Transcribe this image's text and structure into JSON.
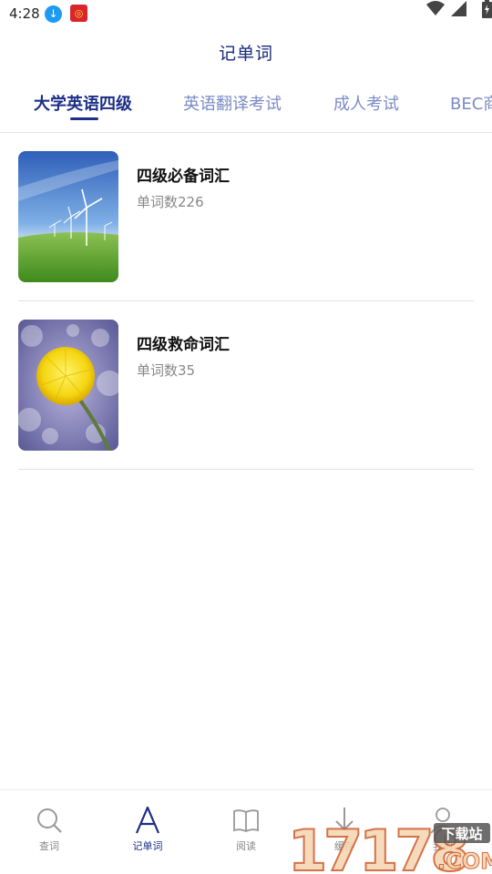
{
  "status_bar": {
    "time": "4:28",
    "download_icon": "download-circle-icon",
    "app_icon": "red-app-icon"
  },
  "header": {
    "title": "记单词"
  },
  "tabs": [
    {
      "label": "大学英语四级",
      "active": true
    },
    {
      "label": "英语翻译考试",
      "active": false
    },
    {
      "label": "成人考试",
      "active": false
    },
    {
      "label": "BEC商",
      "active": false
    }
  ],
  "vocab_list": [
    {
      "title": "四级必备词汇",
      "count": "单词数226",
      "image": "wind-turbines-image"
    },
    {
      "title": "四级救命词汇",
      "count": "单词数35",
      "image": "dandelion-flower-image"
    }
  ],
  "bottom_nav": [
    {
      "label": "查词",
      "icon": "search-icon",
      "active": false
    },
    {
      "label": "记单词",
      "icon": "letter-a-icon",
      "active": true
    },
    {
      "label": "阅读",
      "icon": "book-icon",
      "active": false
    },
    {
      "label": "缓存",
      "icon": "download-icon",
      "active": false
    },
    {
      "label": "我的",
      "icon": "person-icon",
      "active": false
    }
  ],
  "watermark": {
    "text": "17178",
    "sub": "下载站",
    "suffix": ".COM"
  },
  "colors": {
    "accent": "#1c2e86",
    "tab_inactive": "#7b8bc4",
    "divider": "#e2e2e2"
  }
}
